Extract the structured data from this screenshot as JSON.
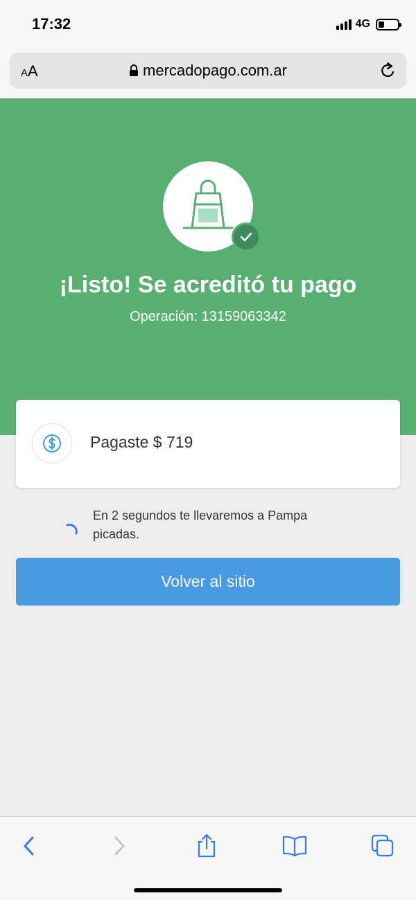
{
  "status_bar": {
    "time": "17:32",
    "network": "4G",
    "battery_level": 0.3
  },
  "browser": {
    "text_size_button": "AA",
    "url": "mercadopago.com.ar",
    "icons": [
      "lock-icon",
      "reload-icon"
    ]
  },
  "hero": {
    "title": "¡Listo! Se acreditó tu pago",
    "operation": "Operación: 13159063342",
    "icons": [
      "shopping-bag-icon",
      "check-icon"
    ],
    "background_color": "#58b070"
  },
  "payment": {
    "label": "Pagaste $ 719",
    "icon": "dollar-coin-icon"
  },
  "redirect": {
    "message": "En 2 segundos te llevaremos a Pampa picadas."
  },
  "actions": {
    "back_button": "Volver al sitio",
    "button_color": "#4799e0"
  },
  "toolbar": {
    "icons": [
      "back-icon",
      "forward-icon",
      "share-icon",
      "bookmarks-icon",
      "tabs-icon"
    ]
  }
}
